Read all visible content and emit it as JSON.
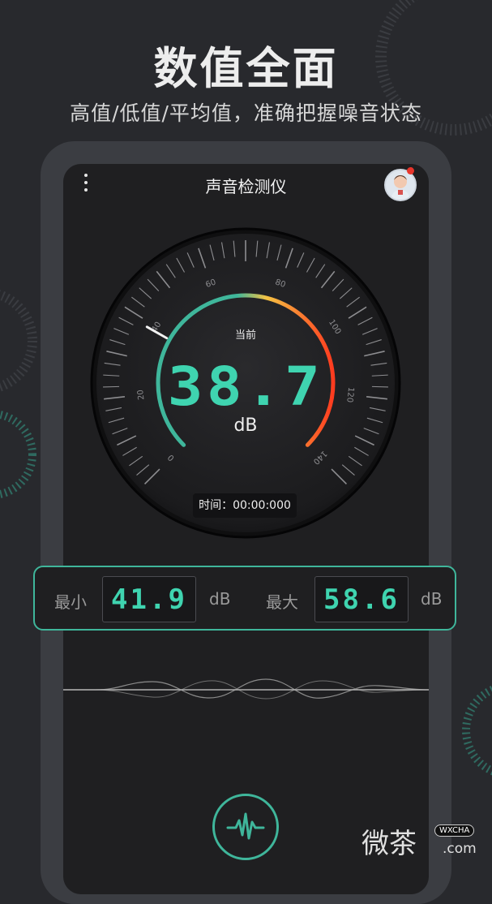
{
  "promo": {
    "headline": "数值全面",
    "subline": "高值/低值/平均值，准确把握噪音状态"
  },
  "app": {
    "title": "声音检测仪"
  },
  "gauge": {
    "scale_labels": [
      "0",
      "20",
      "40",
      "60",
      "80",
      "100",
      "120",
      "140"
    ],
    "current_label": "当前",
    "current_value": "38.7",
    "current_db": 38.7,
    "unit": "dB",
    "time_label": "时间：",
    "time_value": "00:00:000"
  },
  "stats": {
    "min_label": "最小",
    "min_value": "41.9",
    "max_label": "最大",
    "max_value": "58.6",
    "unit": "dB"
  },
  "watermark": {
    "brand": "微茶",
    "badge": "WXCHA",
    "domain": ".com"
  },
  "colors": {
    "accent": "#3fb69b",
    "digits": "#3fd4b0",
    "arc_start": "#3fb69b",
    "arc_mid": "#f5c243",
    "arc_end": "#ff3b1f"
  },
  "icons": {
    "menu": "more-vertical-icon",
    "avatar": "user-avatar",
    "record": "waveform-icon"
  }
}
